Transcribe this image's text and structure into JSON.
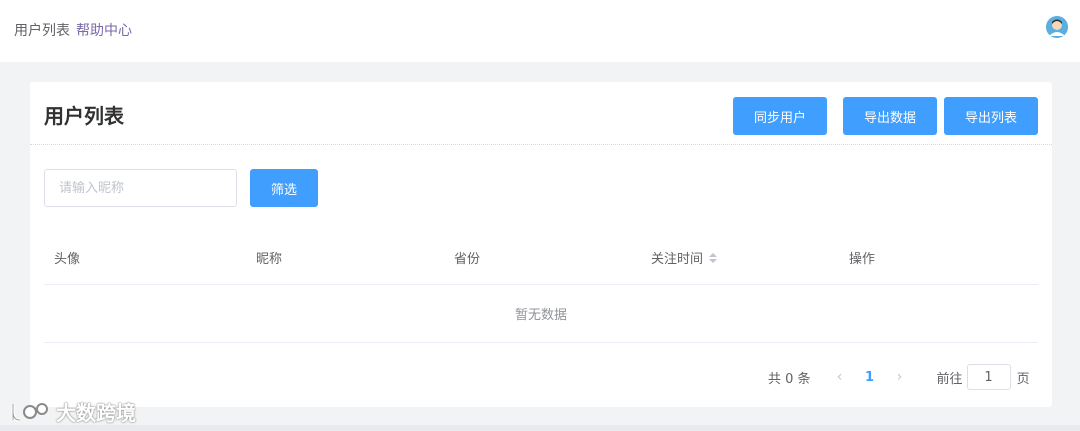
{
  "topbar": {
    "breadcrumbs": [
      {
        "label": "用户列表",
        "active": false
      },
      {
        "label": "帮助中心",
        "active": true
      }
    ],
    "avatar_icon": "user-avatar-icon"
  },
  "card": {
    "title": "用户列表",
    "buttons": {
      "sync": "同步用户",
      "export_data": "导出数据",
      "export_list": "导出列表"
    },
    "filter": {
      "placeholder": "请输入昵称",
      "value": "",
      "button": "筛选"
    },
    "table": {
      "columns": [
        "头像",
        "昵称",
        "省份",
        "关注时间",
        "操作"
      ],
      "empty_text": "暂无数据"
    },
    "pagination": {
      "total_text": "共 0 条",
      "current_page": "1",
      "goto_label": "前往",
      "goto_value": "1",
      "page_suffix": "页"
    }
  },
  "watermark": {
    "text": "大数跨境"
  },
  "colors": {
    "primary": "#409eff",
    "breadcrumb_active": "#7a6aa8",
    "background": "#f2f3f5"
  }
}
